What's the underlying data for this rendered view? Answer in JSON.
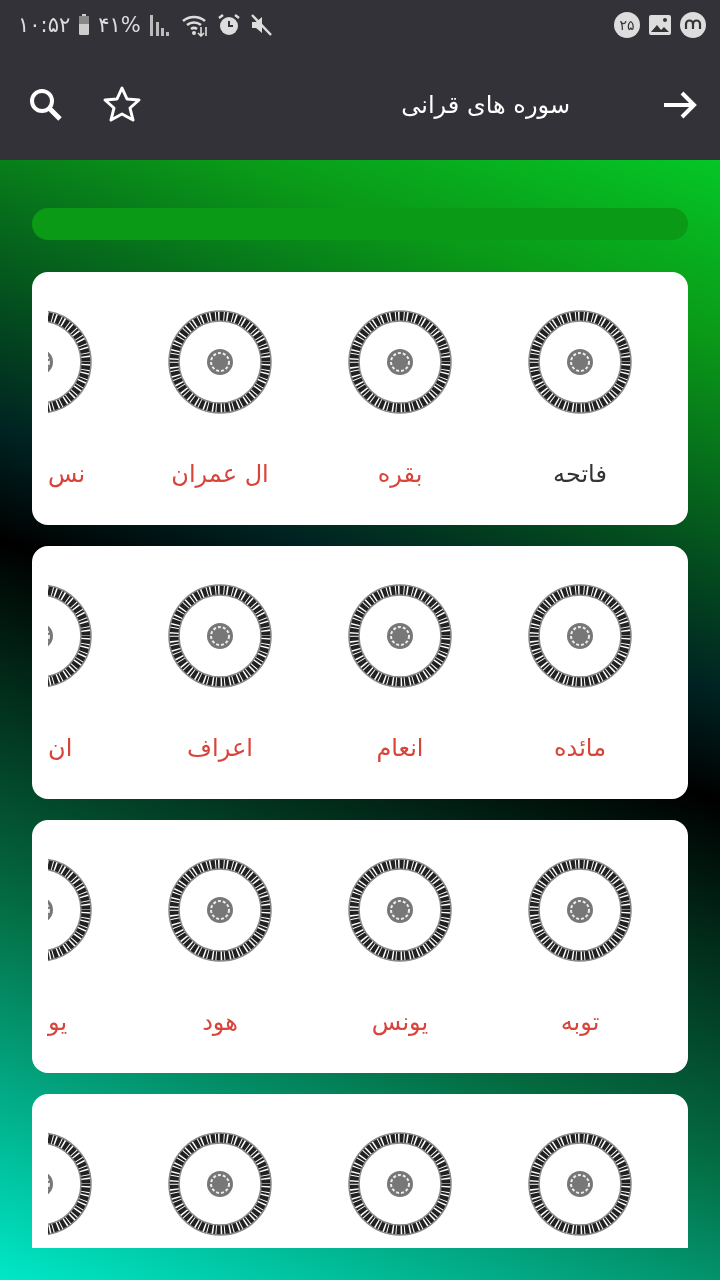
{
  "status_bar": {
    "time": "۱۰:۵۲",
    "battery": "۴۱%",
    "notification_count": "۲۵"
  },
  "app_bar": {
    "title": "سوره های قرانی"
  },
  "cards": [
    {
      "items": [
        {
          "name": "فاتحه",
          "selected": true,
          "partial": false
        },
        {
          "name": "بقره",
          "selected": false,
          "partial": false
        },
        {
          "name": "ال عمران",
          "selected": false,
          "partial": false
        },
        {
          "name": "نس",
          "selected": false,
          "partial": true
        }
      ]
    },
    {
      "items": [
        {
          "name": "مائده",
          "selected": false,
          "partial": false
        },
        {
          "name": "انعام",
          "selected": false,
          "partial": false
        },
        {
          "name": "اعراف",
          "selected": false,
          "partial": false
        },
        {
          "name": "ان",
          "selected": false,
          "partial": true
        }
      ]
    },
    {
      "items": [
        {
          "name": "توبه",
          "selected": false,
          "partial": false
        },
        {
          "name": "یونس",
          "selected": false,
          "partial": false
        },
        {
          "name": "هود",
          "selected": false,
          "partial": false
        },
        {
          "name": "یو",
          "selected": false,
          "partial": true
        }
      ]
    },
    {
      "items": [
        {
          "partial": false
        },
        {
          "partial": false
        },
        {
          "partial": false
        },
        {
          "partial": true
        }
      ]
    }
  ]
}
